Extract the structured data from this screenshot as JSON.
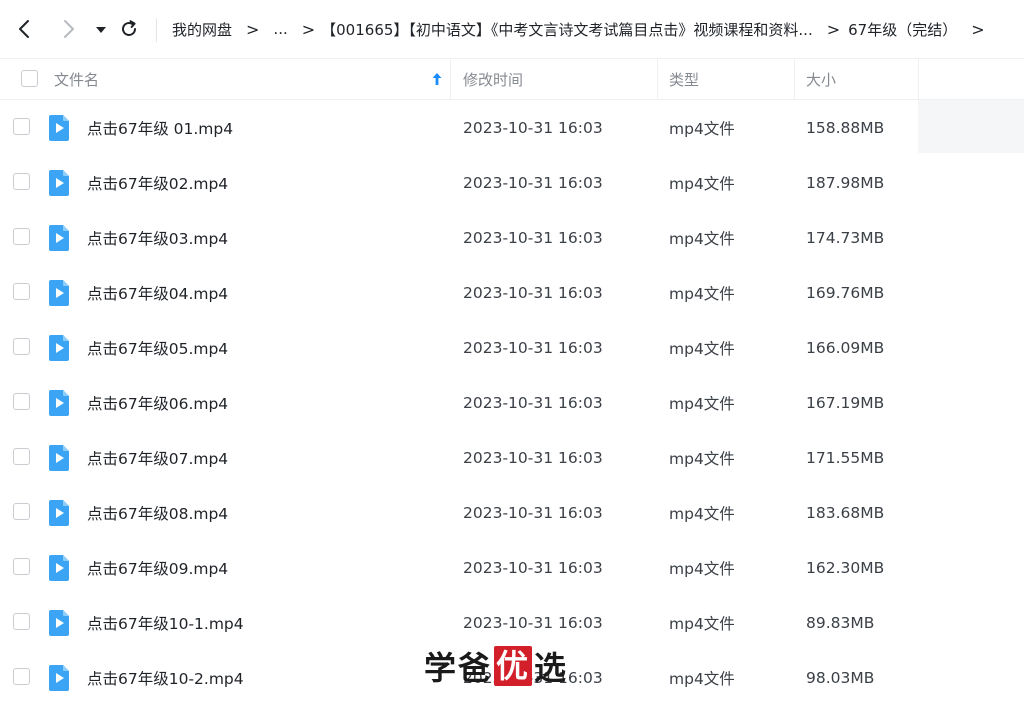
{
  "breadcrumb": {
    "items": [
      "我的网盘",
      "...",
      "【001665】【初中语文】《中考文言诗文考试篇目点击》视频课程和资料...",
      "67年级（完结）"
    ],
    "separator": ">"
  },
  "columns": {
    "name": "文件名",
    "modified": "修改时间",
    "type": "类型",
    "size": "大小"
  },
  "files": [
    {
      "name": "点击67年级 01.mp4",
      "modified": "2023-10-31 16:03",
      "type": "mp4文件",
      "size": "158.88MB"
    },
    {
      "name": "点击67年级02.mp4",
      "modified": "2023-10-31 16:03",
      "type": "mp4文件",
      "size": "187.98MB"
    },
    {
      "name": "点击67年级03.mp4",
      "modified": "2023-10-31 16:03",
      "type": "mp4文件",
      "size": "174.73MB"
    },
    {
      "name": "点击67年级04.mp4",
      "modified": "2023-10-31 16:03",
      "type": "mp4文件",
      "size": "169.76MB"
    },
    {
      "name": "点击67年级05.mp4",
      "modified": "2023-10-31 16:03",
      "type": "mp4文件",
      "size": "166.09MB"
    },
    {
      "name": "点击67年级06.mp4",
      "modified": "2023-10-31 16:03",
      "type": "mp4文件",
      "size": "167.19MB"
    },
    {
      "name": "点击67年级07.mp4",
      "modified": "2023-10-31 16:03",
      "type": "mp4文件",
      "size": "171.55MB"
    },
    {
      "name": "点击67年级08.mp4",
      "modified": "2023-10-31 16:03",
      "type": "mp4文件",
      "size": "183.68MB"
    },
    {
      "name": "点击67年级09.mp4",
      "modified": "2023-10-31 16:03",
      "type": "mp4文件",
      "size": "162.30MB"
    },
    {
      "name": "点击67年级10-1.mp4",
      "modified": "2023-10-31 16:03",
      "type": "mp4文件",
      "size": "89.83MB"
    },
    {
      "name": "点击67年级10-2.mp4",
      "modified": "2023-10-31 16:03",
      "type": "mp4文件",
      "size": "98.03MB"
    }
  ],
  "watermark": {
    "part1": "学爸",
    "highlight": "优",
    "part2": "选"
  },
  "icons": {
    "back": "chevron-left-icon",
    "forward": "chevron-right-icon",
    "dropdown": "caret-down-icon",
    "refresh": "refresh-icon",
    "sort": "sort-ascending-icon",
    "file": "video-file-icon"
  },
  "colors": {
    "accent": "#1a8cff",
    "file_icon": "#3ba4f5",
    "watermark_box": "#d21f2a",
    "header_text": "#858a91"
  }
}
